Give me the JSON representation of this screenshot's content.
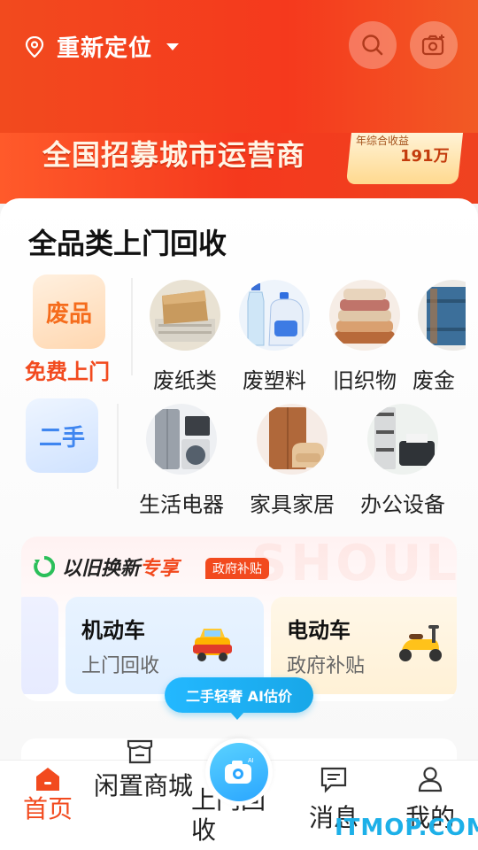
{
  "header": {
    "location_label": "重新定位",
    "icons": [
      "location-pin-icon",
      "search-icon",
      "camera-icon"
    ]
  },
  "banner": {
    "text": "全国招募城市运营商",
    "badge_line1": "年综合收益",
    "badge_line2": "191万"
  },
  "section": {
    "title": "全品类上门回收",
    "free_tile": "废品",
    "free_label": "免费上门",
    "second_tile": "二手",
    "row1": [
      {
        "label": "废纸类",
        "icon": "waste-paper-icon"
      },
      {
        "label": "废塑料",
        "icon": "plastic-bottle-icon"
      },
      {
        "label": "旧织物",
        "icon": "clothes-pile-icon"
      },
      {
        "label": "废金",
        "icon": "metal-barrel-icon"
      }
    ],
    "row2": [
      {
        "label": "生活电器",
        "icon": "appliances-icon"
      },
      {
        "label": "家具家居",
        "icon": "furniture-icon"
      },
      {
        "label": "办公设备",
        "icon": "printer-icon"
      }
    ]
  },
  "trade_in": {
    "title_a": "以旧换新",
    "title_b": "专享",
    "gov_badge": "政府补贴",
    "watermark": "SHOULA",
    "cards": [
      {
        "title": "机动车",
        "desc": "上门回收",
        "icon": "car-icon"
      },
      {
        "title": "电动车",
        "desc": "政府补贴",
        "icon": "scooter-icon"
      }
    ],
    "ai_pill": "二手轻奢 AI估价"
  },
  "tabbar": {
    "items": [
      {
        "label": "首页",
        "icon": "home-icon",
        "active": true
      },
      {
        "label": "闲置商城",
        "icon": "shop-icon",
        "active": false
      },
      {
        "label": "上门回收",
        "icon": "ai-camera-icon",
        "active": false
      },
      {
        "label": "消息",
        "icon": "message-icon",
        "active": false
      },
      {
        "label": "我的",
        "icon": "profile-icon",
        "active": false
      }
    ]
  },
  "watermark": "ITMOP.COM",
  "colors": {
    "brand": "#f24a1e",
    "accent_blue": "#23b8ff"
  }
}
